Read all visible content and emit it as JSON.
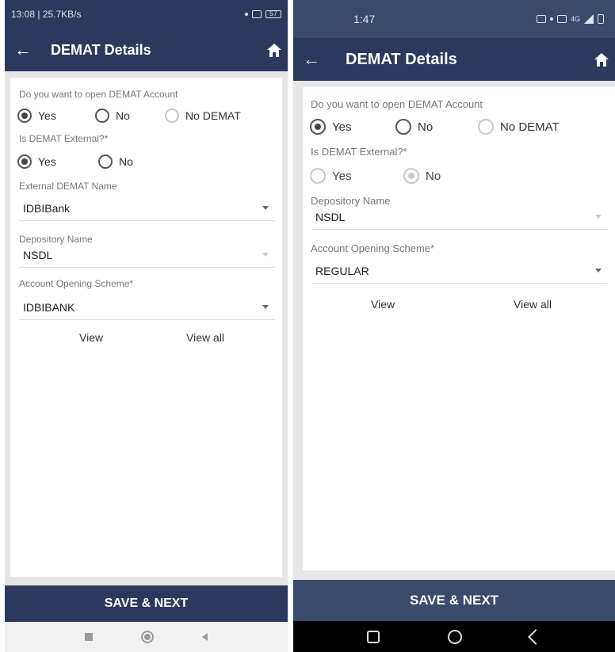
{
  "left": {
    "status": {
      "time_text": "13:08 | 25.7KB/s",
      "battery": "57"
    },
    "header": {
      "title": "DEMAT Details"
    },
    "q_open": {
      "label": "Do you want to open DEMAT Account",
      "options": [
        "Yes",
        "No",
        "No DEMAT"
      ],
      "selected": "Yes"
    },
    "q_external": {
      "label": "Is DEMAT External?*",
      "options": [
        "Yes",
        "No"
      ],
      "selected": "Yes"
    },
    "external_demat": {
      "label": "External DEMAT Name",
      "value": "IDBIBank"
    },
    "depository": {
      "label": "Depository Name",
      "value": "NSDL"
    },
    "scheme": {
      "label": "Account Opening Scheme*",
      "value": "IDBIBANK"
    },
    "links": {
      "view": "View",
      "view_all": "View all"
    },
    "save_label": "SAVE & NEXT"
  },
  "right": {
    "status": {
      "time_text": "1:47",
      "network": "4G"
    },
    "header": {
      "title": "DEMAT Details"
    },
    "q_open": {
      "label": "Do you want to open DEMAT Account",
      "options": [
        "Yes",
        "No",
        "No DEMAT"
      ],
      "selected": "Yes"
    },
    "q_external": {
      "label": "Is DEMAT External?*",
      "options": [
        "Yes",
        "No"
      ],
      "selected": "No",
      "disabled": true
    },
    "depository": {
      "label": "Depository Name",
      "value": "NSDL"
    },
    "scheme": {
      "label": "Account Opening Scheme*",
      "value": "REGULAR"
    },
    "links": {
      "view": "View",
      "view_all": "View all"
    },
    "save_label": "SAVE & NEXT"
  },
  "colors": {
    "primary": "#2b3a5c",
    "background": "#e6e6e6",
    "card": "#ffffff"
  },
  "icons": [
    "back-arrow-icon",
    "home-icon",
    "caret-down-icon",
    "nav-recents-icon",
    "nav-home-icon",
    "nav-back-icon"
  ]
}
